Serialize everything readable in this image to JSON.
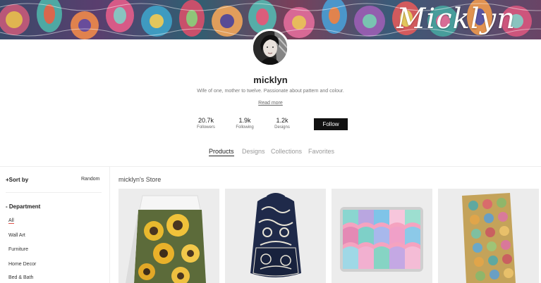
{
  "banner": {
    "logo_text": "Micklyn"
  },
  "profile": {
    "username": "micklyn",
    "bio": "Wife of one, mother to twelve. Passionate about pattern and colour.",
    "read_more": "Read more",
    "avatar_icon": "profile-photo"
  },
  "stats": [
    {
      "value": "20.7k",
      "label": "Followers"
    },
    {
      "value": "1.9k",
      "label": "Following"
    },
    {
      "value": "1.2k",
      "label": "Designs"
    }
  ],
  "follow_label": "Follow",
  "tabs": [
    {
      "label": "Products",
      "active": true
    },
    {
      "label": "Designs",
      "active": false
    },
    {
      "label": "Collections",
      "active": false
    },
    {
      "label": "Favorites",
      "active": false
    }
  ],
  "sidebar": {
    "sort_label": "+Sort by",
    "sort_value": "Random",
    "department_label": "- Department",
    "departments": [
      "All",
      "Wall Art",
      "Furniture",
      "Home Decor",
      "Bed & Bath"
    ]
  },
  "store_title": "micklyn's Store",
  "products": [
    {
      "name": "duvet-cover"
    },
    {
      "name": "backpack"
    },
    {
      "name": "laptop-skin"
    },
    {
      "name": "phone-case"
    }
  ],
  "colors": {
    "accent": "#e0524a",
    "follow_bg": "#111111"
  }
}
